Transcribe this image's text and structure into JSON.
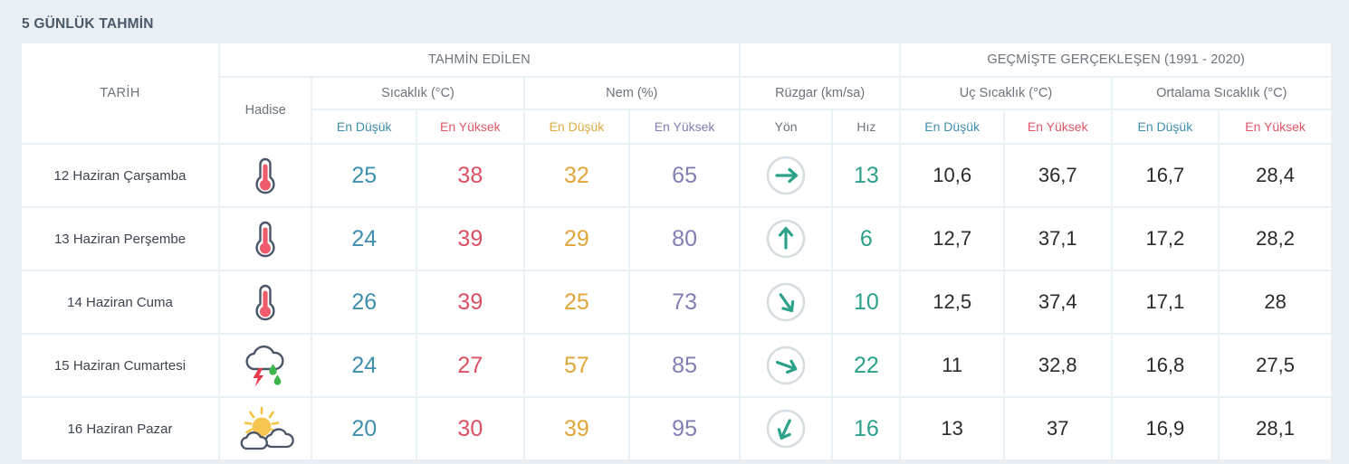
{
  "page": {
    "title": "5 GÜNLÜK TAHMİN",
    "background_color": "#eaeff3",
    "accent_colors": {
      "low_temp": "#3f8fae",
      "high_temp": "#db4f63",
      "humidity_low": "#e0a63a",
      "humidity_high": "#7f7fb3",
      "wind": "#2ba289",
      "historical": "#2b2b2b",
      "title": "#4a5a6a",
      "grid": "#e8f1f6"
    }
  },
  "header": {
    "date_column": "TARİH",
    "event_column": "Hadise",
    "group_forecast": "TAHMİN EDİLEN",
    "group_historical": "GEÇMİŞTE GERÇEKLEŞEN (1991 - 2020)",
    "sub_temperature": "Sıcaklık (°C)",
    "sub_humidity": "Nem (%)",
    "sub_wind": "Rüzgar (km/sa)",
    "sub_extreme_temp": "Uç Sıcaklık (°C)",
    "sub_average_temp": "Ortalama Sıcaklık (°C)",
    "leaf_min": "En Düşük",
    "leaf_max": "En Yüksek",
    "leaf_direction": "Yön",
    "leaf_speed": "Hız"
  },
  "rows": [
    {
      "date": "12 Haziran Çarşamba",
      "event_icon": "thermometer-icon",
      "temp_min": "25",
      "temp_max": "38",
      "humidity_min": "32",
      "humidity_max": "65",
      "wind_direction_icon": "wind-arrow-icon",
      "wind_direction_deg": 90,
      "wind_speed": "13",
      "hist_extreme_min": "10,6",
      "hist_extreme_max": "36,7",
      "hist_avg_min": "16,7",
      "hist_avg_max": "28,4"
    },
    {
      "date": "13 Haziran Perşembe",
      "event_icon": "thermometer-icon",
      "temp_min": "24",
      "temp_max": "39",
      "humidity_min": "29",
      "humidity_max": "80",
      "wind_direction_icon": "wind-arrow-icon",
      "wind_direction_deg": 0,
      "wind_speed": "6",
      "hist_extreme_min": "12,7",
      "hist_extreme_max": "37,1",
      "hist_avg_min": "17,2",
      "hist_avg_max": "28,2"
    },
    {
      "date": "14 Haziran Cuma",
      "event_icon": "thermometer-icon",
      "temp_min": "26",
      "temp_max": "39",
      "humidity_min": "25",
      "humidity_max": "73",
      "wind_direction_icon": "wind-arrow-icon",
      "wind_direction_deg": 145,
      "wind_speed": "10",
      "hist_extreme_min": "12,5",
      "hist_extreme_max": "37,4",
      "hist_avg_min": "17,1",
      "hist_avg_max": "28"
    },
    {
      "date": "15 Haziran Cumartesi",
      "event_icon": "thunderstorm-rain-icon",
      "temp_min": "24",
      "temp_max": "27",
      "humidity_min": "57",
      "humidity_max": "85",
      "wind_direction_icon": "wind-arrow-icon",
      "wind_direction_deg": 110,
      "wind_speed": "22",
      "hist_extreme_min": "11",
      "hist_extreme_max": "32,8",
      "hist_avg_min": "16,8",
      "hist_avg_max": "27,5"
    },
    {
      "date": "16 Haziran Pazar",
      "event_icon": "sun-behind-clouds-icon",
      "temp_min": "20",
      "temp_max": "30",
      "humidity_min": "39",
      "humidity_max": "95",
      "wind_direction_icon": "wind-arrow-icon",
      "wind_direction_deg": 205,
      "wind_speed": "16",
      "hist_extreme_min": "13",
      "hist_extreme_max": "37",
      "hist_avg_min": "16,9",
      "hist_avg_max": "28,1"
    }
  ]
}
